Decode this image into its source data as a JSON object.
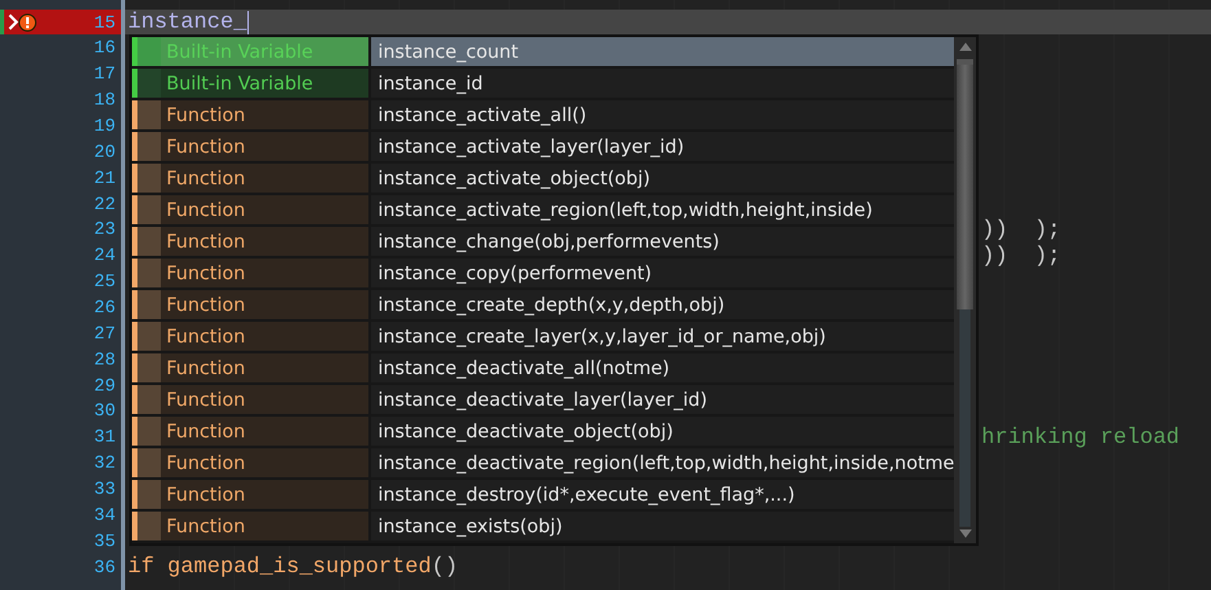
{
  "editor": {
    "lines": [
      {
        "number": "15",
        "current": true,
        "error": true,
        "kind": "code",
        "segments": [
          {
            "text": "instance_",
            "kind": "typed"
          }
        ]
      },
      {
        "number": "16",
        "current": false,
        "error": false,
        "kind": "code"
      },
      {
        "number": "17",
        "current": false,
        "error": false,
        "kind": "code"
      },
      {
        "number": "18",
        "current": false,
        "error": false,
        "kind": "code"
      },
      {
        "number": "19",
        "current": false,
        "error": false,
        "kind": "code"
      },
      {
        "number": "20",
        "current": false,
        "error": false,
        "kind": "code"
      },
      {
        "number": "21",
        "current": false,
        "error": false,
        "kind": "code"
      },
      {
        "number": "22",
        "current": false,
        "error": false,
        "kind": "code"
      },
      {
        "number": "23",
        "current": false,
        "error": false,
        "kind": "tail",
        "segments": [
          {
            "text": "))  );",
            "kind": "punct"
          }
        ]
      },
      {
        "number": "24",
        "current": false,
        "error": false,
        "kind": "tail",
        "segments": [
          {
            "text": "))  );",
            "kind": "punct"
          }
        ]
      },
      {
        "number": "25",
        "current": false,
        "error": false,
        "kind": "code"
      },
      {
        "number": "26",
        "current": false,
        "error": false,
        "kind": "code"
      },
      {
        "number": "27",
        "current": false,
        "error": false,
        "kind": "code"
      },
      {
        "number": "28",
        "current": false,
        "error": false,
        "kind": "code"
      },
      {
        "number": "29",
        "current": false,
        "error": false,
        "kind": "code"
      },
      {
        "number": "30",
        "current": false,
        "error": false,
        "kind": "code"
      },
      {
        "number": "31",
        "current": false,
        "error": false,
        "kind": "tail",
        "segments": [
          {
            "text": "hrinking reload",
            "kind": "comment"
          }
        ]
      },
      {
        "number": "32",
        "current": false,
        "error": false,
        "kind": "code"
      },
      {
        "number": "33",
        "current": false,
        "error": false,
        "kind": "code"
      },
      {
        "number": "34",
        "current": false,
        "error": false,
        "kind": "code"
      },
      {
        "number": "35",
        "current": false,
        "error": false,
        "kind": "code"
      },
      {
        "number": "36",
        "current": false,
        "error": false,
        "kind": "code",
        "segments": [
          {
            "text": "if gamepad_is_supported",
            "kind": "keyword"
          },
          {
            "text": "()",
            "kind": "punct"
          }
        ]
      }
    ]
  },
  "autocomplete": {
    "items": [
      {
        "kind": "variable",
        "type_label": "Built-in Variable",
        "name": "instance_count",
        "selected": true
      },
      {
        "kind": "variable",
        "type_label": "Built-in Variable",
        "name": "instance_id",
        "selected": false
      },
      {
        "kind": "function",
        "type_label": "Function",
        "name": "instance_activate_all()",
        "selected": false
      },
      {
        "kind": "function",
        "type_label": "Function",
        "name": "instance_activate_layer(layer_id)",
        "selected": false
      },
      {
        "kind": "function",
        "type_label": "Function",
        "name": "instance_activate_object(obj)",
        "selected": false
      },
      {
        "kind": "function",
        "type_label": "Function",
        "name": "instance_activate_region(left,top,width,height,inside)",
        "selected": false
      },
      {
        "kind": "function",
        "type_label": "Function",
        "name": "instance_change(obj,performevents)",
        "selected": false
      },
      {
        "kind": "function",
        "type_label": "Function",
        "name": "instance_copy(performevent)",
        "selected": false
      },
      {
        "kind": "function",
        "type_label": "Function",
        "name": "instance_create_depth(x,y,depth,obj)",
        "selected": false
      },
      {
        "kind": "function",
        "type_label": "Function",
        "name": "instance_create_layer(x,y,layer_id_or_name,obj)",
        "selected": false
      },
      {
        "kind": "function",
        "type_label": "Function",
        "name": "instance_deactivate_all(notme)",
        "selected": false
      },
      {
        "kind": "function",
        "type_label": "Function",
        "name": "instance_deactivate_layer(layer_id)",
        "selected": false
      },
      {
        "kind": "function",
        "type_label": "Function",
        "name": "instance_deactivate_object(obj)",
        "selected": false
      },
      {
        "kind": "function",
        "type_label": "Function",
        "name": "instance_deactivate_region(left,top,width,height,inside,notme",
        "selected": false
      },
      {
        "kind": "function",
        "type_label": "Function",
        "name": "instance_destroy(id*,execute_event_flag*,...)",
        "selected": false
      },
      {
        "kind": "function",
        "type_label": "Function",
        "name": "instance_exists(obj)",
        "selected": false
      }
    ]
  }
}
